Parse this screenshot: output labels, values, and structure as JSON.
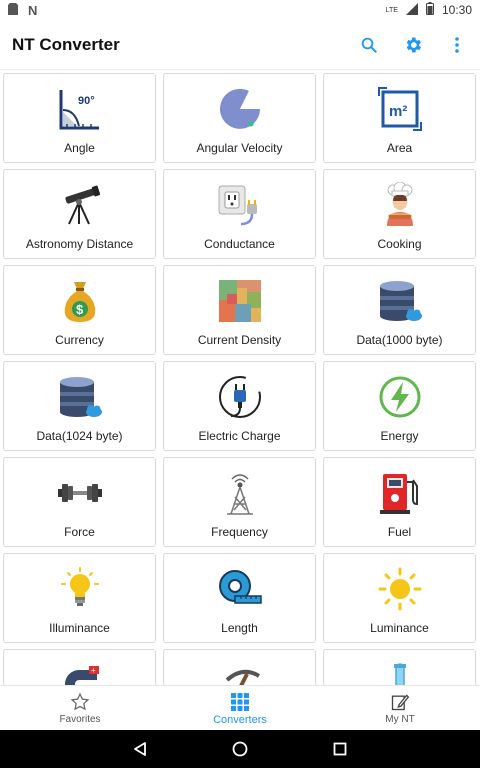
{
  "status": {
    "time": "10:30",
    "network": "LTE"
  },
  "app": {
    "title": "NT Converter"
  },
  "colors": {
    "accent": "#2196F3"
  },
  "icons": {
    "search": "search-icon",
    "settings": "gear-icon",
    "more": "more-vertical-icon"
  },
  "converters": [
    {
      "label": "Angle",
      "icon": "angle-icon"
    },
    {
      "label": "Angular Velocity",
      "icon": "angular-velocity-icon"
    },
    {
      "label": "Area",
      "icon": "area-icon"
    },
    {
      "label": "Astronomy Distance",
      "icon": "telescope-icon"
    },
    {
      "label": "Conductance",
      "icon": "power-outlet-icon"
    },
    {
      "label": "Cooking",
      "icon": "chef-icon"
    },
    {
      "label": "Currency",
      "icon": "money-bag-icon"
    },
    {
      "label": "Current Density",
      "icon": "density-map-icon"
    },
    {
      "label": "Data(1000 byte)",
      "icon": "database-cloud-icon"
    },
    {
      "label": "Data(1024 byte)",
      "icon": "database-cloud-icon"
    },
    {
      "label": "Electric Charge",
      "icon": "plug-icon"
    },
    {
      "label": "Energy",
      "icon": "lightning-icon"
    },
    {
      "label": "Force",
      "icon": "dumbbell-icon"
    },
    {
      "label": "Frequency",
      "icon": "antenna-tower-icon"
    },
    {
      "label": "Fuel",
      "icon": "fuel-pump-icon"
    },
    {
      "label": "Illuminance",
      "icon": "light-bulb-icon"
    },
    {
      "label": "Length",
      "icon": "tape-measure-icon"
    },
    {
      "label": "Luminance",
      "icon": "sun-icon"
    },
    {
      "label": "",
      "icon": "magnet-icon"
    },
    {
      "label": "",
      "icon": "pickaxe-icon"
    },
    {
      "label": "",
      "icon": "test-tube-icon"
    }
  ],
  "angle_icon_text": "90°",
  "area_icon_text": "m²",
  "currency_icon_text": "$",
  "bottom_nav": {
    "favorites": "Favorites",
    "converters": "Converters",
    "my_nt": "My NT"
  }
}
